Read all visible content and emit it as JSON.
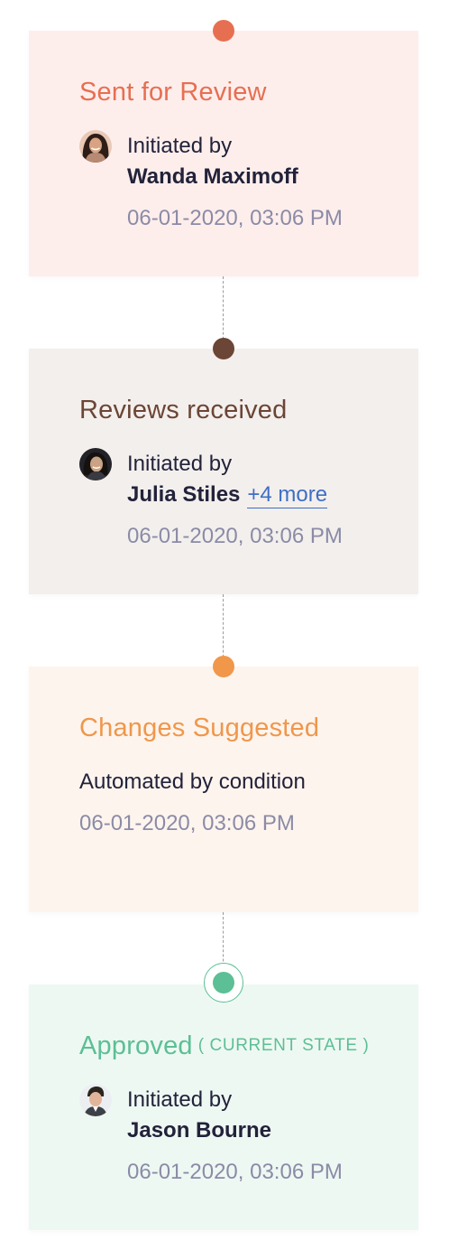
{
  "timeline": {
    "items": [
      {
        "title": "Sent for Review",
        "title_color": "#e76f51",
        "card_bg": "#fdeeec",
        "dot_color": "#e76f51",
        "initiated_label": "Initiated by",
        "person": "Wanda Maximoff",
        "timestamp": "06-01-2020, 03:06 PM",
        "avatar_icon": "user-avatar-icon"
      },
      {
        "title": "Reviews received",
        "title_color": "#6b4535",
        "card_bg": "#f3efed",
        "dot_color": "#6b4535",
        "initiated_label": "Initiated by",
        "person": "Julia Stiles",
        "more_link": "+4 more",
        "more_link_color": "#3e6fc4",
        "timestamp": "06-01-2020, 03:06 PM",
        "avatar_icon": "user-avatar-icon"
      },
      {
        "title": "Changes Suggested",
        "title_color": "#f0974a",
        "card_bg": "#fdf4ee",
        "dot_color": "#f0974a",
        "automated_label": "Automated by condition",
        "timestamp": "06-01-2020, 03:06 PM"
      },
      {
        "title": "Approved",
        "title_color": "#5cbf95",
        "card_bg": "#eef8f3",
        "dot_color": "#5cbf95",
        "current_state_tag": "( CURRENT STATE )",
        "initiated_label": "Initiated by",
        "person": "Jason Bourne",
        "timestamp": "06-01-2020, 03:06 PM",
        "avatar_icon": "user-avatar-icon"
      }
    ]
  }
}
